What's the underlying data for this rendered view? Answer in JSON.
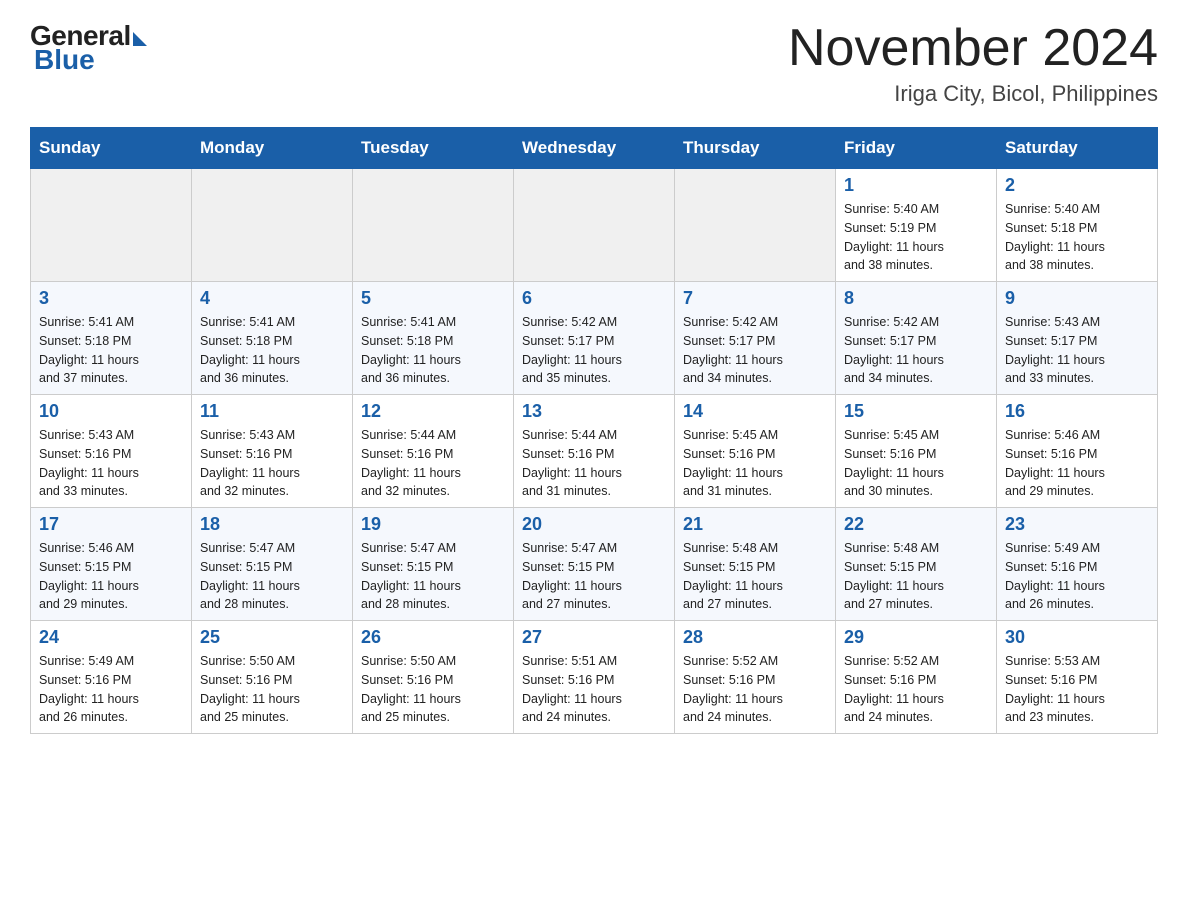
{
  "header": {
    "logo": {
      "general": "General",
      "blue": "Blue"
    },
    "title": "November 2024",
    "location": "Iriga City, Bicol, Philippines"
  },
  "calendar": {
    "days_of_week": [
      "Sunday",
      "Monday",
      "Tuesday",
      "Wednesday",
      "Thursday",
      "Friday",
      "Saturday"
    ],
    "weeks": [
      [
        {
          "day": "",
          "info": ""
        },
        {
          "day": "",
          "info": ""
        },
        {
          "day": "",
          "info": ""
        },
        {
          "day": "",
          "info": ""
        },
        {
          "day": "",
          "info": ""
        },
        {
          "day": "1",
          "info": "Sunrise: 5:40 AM\nSunset: 5:19 PM\nDaylight: 11 hours\nand 38 minutes."
        },
        {
          "day": "2",
          "info": "Sunrise: 5:40 AM\nSunset: 5:18 PM\nDaylight: 11 hours\nand 38 minutes."
        }
      ],
      [
        {
          "day": "3",
          "info": "Sunrise: 5:41 AM\nSunset: 5:18 PM\nDaylight: 11 hours\nand 37 minutes."
        },
        {
          "day": "4",
          "info": "Sunrise: 5:41 AM\nSunset: 5:18 PM\nDaylight: 11 hours\nand 36 minutes."
        },
        {
          "day": "5",
          "info": "Sunrise: 5:41 AM\nSunset: 5:18 PM\nDaylight: 11 hours\nand 36 minutes."
        },
        {
          "day": "6",
          "info": "Sunrise: 5:42 AM\nSunset: 5:17 PM\nDaylight: 11 hours\nand 35 minutes."
        },
        {
          "day": "7",
          "info": "Sunrise: 5:42 AM\nSunset: 5:17 PM\nDaylight: 11 hours\nand 34 minutes."
        },
        {
          "day": "8",
          "info": "Sunrise: 5:42 AM\nSunset: 5:17 PM\nDaylight: 11 hours\nand 34 minutes."
        },
        {
          "day": "9",
          "info": "Sunrise: 5:43 AM\nSunset: 5:17 PM\nDaylight: 11 hours\nand 33 minutes."
        }
      ],
      [
        {
          "day": "10",
          "info": "Sunrise: 5:43 AM\nSunset: 5:16 PM\nDaylight: 11 hours\nand 33 minutes."
        },
        {
          "day": "11",
          "info": "Sunrise: 5:43 AM\nSunset: 5:16 PM\nDaylight: 11 hours\nand 32 minutes."
        },
        {
          "day": "12",
          "info": "Sunrise: 5:44 AM\nSunset: 5:16 PM\nDaylight: 11 hours\nand 32 minutes."
        },
        {
          "day": "13",
          "info": "Sunrise: 5:44 AM\nSunset: 5:16 PM\nDaylight: 11 hours\nand 31 minutes."
        },
        {
          "day": "14",
          "info": "Sunrise: 5:45 AM\nSunset: 5:16 PM\nDaylight: 11 hours\nand 31 minutes."
        },
        {
          "day": "15",
          "info": "Sunrise: 5:45 AM\nSunset: 5:16 PM\nDaylight: 11 hours\nand 30 minutes."
        },
        {
          "day": "16",
          "info": "Sunrise: 5:46 AM\nSunset: 5:16 PM\nDaylight: 11 hours\nand 29 minutes."
        }
      ],
      [
        {
          "day": "17",
          "info": "Sunrise: 5:46 AM\nSunset: 5:15 PM\nDaylight: 11 hours\nand 29 minutes."
        },
        {
          "day": "18",
          "info": "Sunrise: 5:47 AM\nSunset: 5:15 PM\nDaylight: 11 hours\nand 28 minutes."
        },
        {
          "day": "19",
          "info": "Sunrise: 5:47 AM\nSunset: 5:15 PM\nDaylight: 11 hours\nand 28 minutes."
        },
        {
          "day": "20",
          "info": "Sunrise: 5:47 AM\nSunset: 5:15 PM\nDaylight: 11 hours\nand 27 minutes."
        },
        {
          "day": "21",
          "info": "Sunrise: 5:48 AM\nSunset: 5:15 PM\nDaylight: 11 hours\nand 27 minutes."
        },
        {
          "day": "22",
          "info": "Sunrise: 5:48 AM\nSunset: 5:15 PM\nDaylight: 11 hours\nand 27 minutes."
        },
        {
          "day": "23",
          "info": "Sunrise: 5:49 AM\nSunset: 5:16 PM\nDaylight: 11 hours\nand 26 minutes."
        }
      ],
      [
        {
          "day": "24",
          "info": "Sunrise: 5:49 AM\nSunset: 5:16 PM\nDaylight: 11 hours\nand 26 minutes."
        },
        {
          "day": "25",
          "info": "Sunrise: 5:50 AM\nSunset: 5:16 PM\nDaylight: 11 hours\nand 25 minutes."
        },
        {
          "day": "26",
          "info": "Sunrise: 5:50 AM\nSunset: 5:16 PM\nDaylight: 11 hours\nand 25 minutes."
        },
        {
          "day": "27",
          "info": "Sunrise: 5:51 AM\nSunset: 5:16 PM\nDaylight: 11 hours\nand 24 minutes."
        },
        {
          "day": "28",
          "info": "Sunrise: 5:52 AM\nSunset: 5:16 PM\nDaylight: 11 hours\nand 24 minutes."
        },
        {
          "day": "29",
          "info": "Sunrise: 5:52 AM\nSunset: 5:16 PM\nDaylight: 11 hours\nand 24 minutes."
        },
        {
          "day": "30",
          "info": "Sunrise: 5:53 AM\nSunset: 5:16 PM\nDaylight: 11 hours\nand 23 minutes."
        }
      ]
    ]
  }
}
